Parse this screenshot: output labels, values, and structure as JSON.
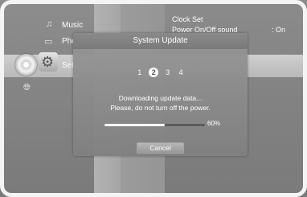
{
  "menu": {
    "items": [
      {
        "icon": "music-note-icon",
        "label": "Music"
      },
      {
        "icon": "photo-icon",
        "label": "Photo"
      },
      {
        "icon": "gear-icon",
        "label": "Setup"
      },
      {
        "icon": "globe-icon",
        "label": ""
      }
    ]
  },
  "settings_panel": {
    "clock_set_label": "Clock Set",
    "power_sound_label": "Power On/Off sound",
    "power_sound_value": ": On"
  },
  "dialog": {
    "title": "System Update",
    "steps": [
      "1",
      "2",
      "3",
      "4"
    ],
    "active_step": 2,
    "message_line1": "Downloading update data...",
    "message_line2": "Please, do not turn off the power.",
    "progress": 0.6,
    "progress_label": "60%",
    "cancel_label": "Cancel"
  }
}
